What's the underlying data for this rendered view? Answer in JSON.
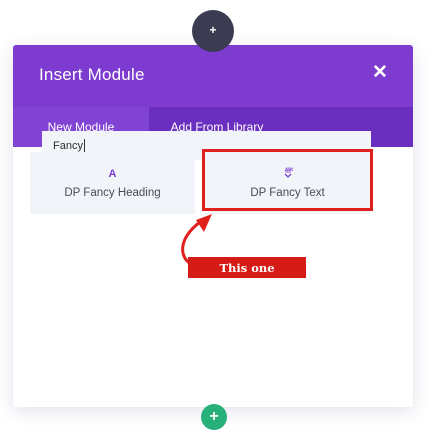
{
  "top_add_button": {
    "label": "+"
  },
  "modal": {
    "title": "Insert Module",
    "close_label": "✕",
    "tabs": [
      {
        "label": "New Module",
        "active": true
      },
      {
        "label": "Add From Library",
        "active": false
      }
    ],
    "search": {
      "value": "Fancy"
    },
    "results": [
      {
        "icon_glyph": "A",
        "icon": "text-a-icon",
        "label": "DP Fancy Heading"
      },
      {
        "icon_glyph": "⸮",
        "icon": "fancy-text-icon",
        "label": "DP Fancy Text"
      }
    ]
  },
  "annotation": {
    "callout": "This one",
    "color": "#e0201c"
  },
  "bottom_add_button": {
    "label": "+"
  },
  "colors": {
    "header": "#7e3bd0",
    "tabs_bar": "#6b2fc0",
    "active_tab": "#8143d4",
    "card_bg": "#f1f4f9",
    "add_button_dark": "#3b3b52",
    "add_button_green": "#27b07a"
  }
}
